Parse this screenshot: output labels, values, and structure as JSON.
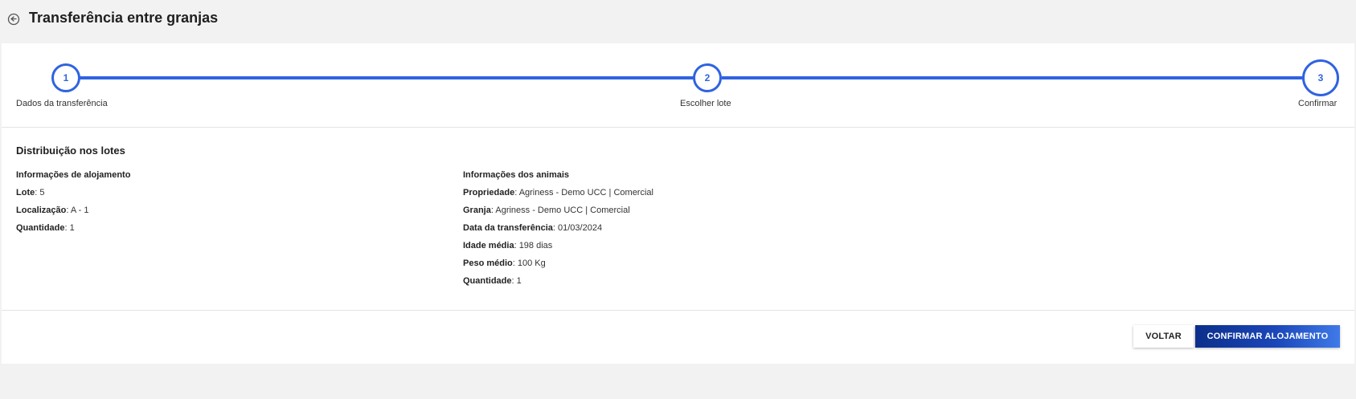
{
  "header": {
    "title": "Transferência entre granjas",
    "back_icon": "back-arrow-circle-icon"
  },
  "stepper": {
    "steps": [
      {
        "number": "1",
        "label": "Dados da transferência"
      },
      {
        "number": "2",
        "label": "Escolher lote"
      },
      {
        "number": "3",
        "label": "Confirmar"
      }
    ],
    "current_step": 3,
    "accent_color": "#2f63e0"
  },
  "distribution": {
    "title": "Distribuição nos lotes",
    "housing": {
      "heading": "Informações de alojamento",
      "rows": [
        {
          "label": "Lote",
          "value": ": 5"
        },
        {
          "label": "Localização",
          "value": ": A - 1"
        },
        {
          "label": "Quantidade",
          "value": ": 1"
        }
      ]
    },
    "animals": {
      "heading": "Informações dos animais",
      "rows": [
        {
          "label": "Propriedade",
          "value": ": Agriness - Demo UCC | Comercial"
        },
        {
          "label": "Granja",
          "value": ": Agriness - Demo UCC | Comercial"
        },
        {
          "label": "Data da transferência",
          "value": ": 01/03/2024"
        },
        {
          "label": "Idade média",
          "value": ": 198 dias"
        },
        {
          "label": "Peso médio",
          "value": ": 100 Kg"
        },
        {
          "label": "Quantidade",
          "value": ": 1"
        }
      ]
    }
  },
  "footer": {
    "back_label": "VOLTAR",
    "confirm_label": "CONFIRMAR ALOJAMENTO",
    "confirm_color": "#1a46b8"
  }
}
